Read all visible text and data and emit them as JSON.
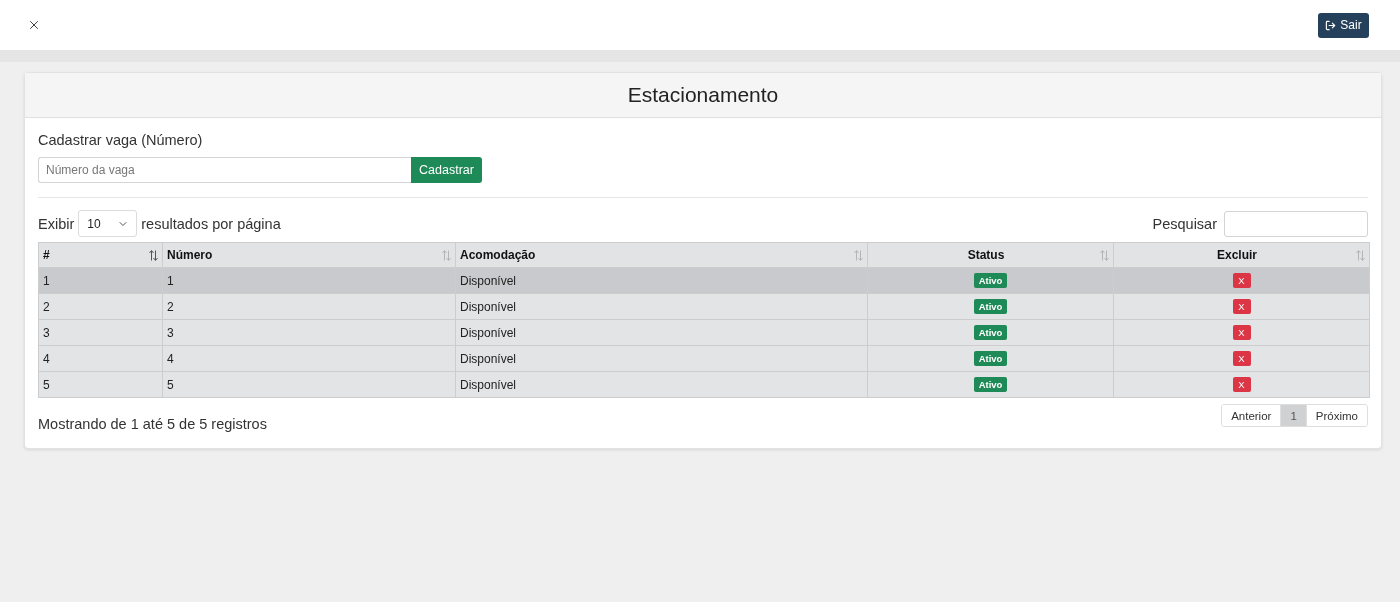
{
  "topbar": {
    "logout_button": "Sair"
  },
  "card": {
    "title": "Estacionamento"
  },
  "register_form": {
    "label": "Cadastrar vaga (Número)",
    "placeholder": "Número da vaga",
    "button": "Cadastrar"
  },
  "length_control": {
    "prefix": "Exibir",
    "value": "10",
    "suffix": "resultados por página"
  },
  "search": {
    "label": "Pesquisar"
  },
  "table": {
    "columns": [
      {
        "label": "#",
        "centered": false,
        "sorted": true
      },
      {
        "label": "Número",
        "centered": false,
        "sorted": false
      },
      {
        "label": "Acomodação",
        "centered": false,
        "sorted": false
      },
      {
        "label": "Status",
        "centered": true,
        "sorted": false
      },
      {
        "label": "Excluir",
        "centered": true,
        "sorted": false
      }
    ],
    "rows": [
      {
        "selected": true,
        "index": "1",
        "number": "1",
        "accommodation": "Disponível",
        "status": "Ativo",
        "delete": "X"
      },
      {
        "selected": false,
        "index": "2",
        "number": "2",
        "accommodation": "Disponível",
        "status": "Ativo",
        "delete": "X"
      },
      {
        "selected": false,
        "index": "3",
        "number": "3",
        "accommodation": "Disponível",
        "status": "Ativo",
        "delete": "X"
      },
      {
        "selected": false,
        "index": "4",
        "number": "4",
        "accommodation": "Disponível",
        "status": "Ativo",
        "delete": "X"
      },
      {
        "selected": false,
        "index": "5",
        "number": "5",
        "accommodation": "Disponível",
        "status": "Ativo",
        "delete": "X"
      }
    ]
  },
  "info": "Mostrando de 1 até 5 de 5 registros",
  "pagination": {
    "previous": "Anterior",
    "pages": [
      {
        "label": "1",
        "selected": true
      }
    ],
    "next": "Próximo"
  }
}
